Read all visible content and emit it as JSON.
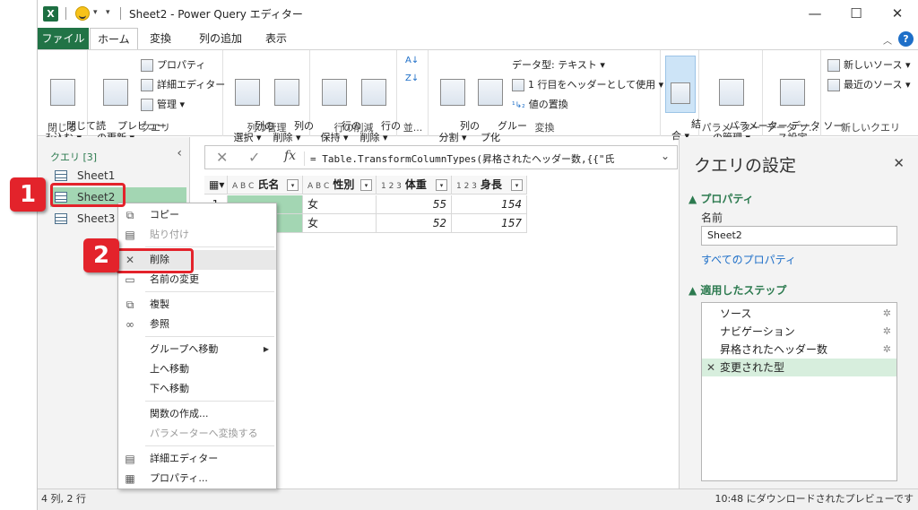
{
  "title": {
    "app_icon": "X",
    "window_title": "Sheet2 - Power Query エディター",
    "minimize": "—",
    "maximize": "☐",
    "close": "✕"
  },
  "tabs": [
    "ファイル",
    "ホーム",
    "変換",
    "列の追加",
    "表示"
  ],
  "ribbon": {
    "close_group": {
      "button": "閉じて読\nみ込む ▾",
      "label": "閉じる"
    },
    "query_group": {
      "preview": "プレビュー\nの更新 ▾",
      "properties": "プロパティ",
      "advanced_editor": "詳細エディター",
      "manage": "管理 ▾",
      "label": "クエリ"
    },
    "column_manage_group": {
      "select_columns": "列の\n選択 ▾",
      "remove_columns": "列の\n削除 ▾",
      "label": "列の管理"
    },
    "row_reduce_group": {
      "keep_rows": "行の\n保持 ▾",
      "remove_rows": "行の\n削除 ▾",
      "label": "行の削減"
    },
    "sort_group": {
      "label": "並..."
    },
    "transform_group": {
      "split_column": "列の\n分割 ▾",
      "group_by": "グルー\nプ化",
      "data_type": "データ型: テキスト ▾",
      "use_first_row": "1 行目をヘッダーとして使用 ▾",
      "replace_values": "値の置換",
      "label": "変換"
    },
    "combine_group": {
      "combine": "結\n合 ▾"
    },
    "parameter_group": {
      "manage_parameters": "パラメーター\nの管理 ▾",
      "label": "パラメーター"
    },
    "datasource_group": {
      "settings": "データ ソー\nス設定",
      "label": "データ ソ..."
    },
    "newquery_group": {
      "new_source": "新しいソース ▾",
      "recent_sources": "最近のソース ▾",
      "label": "新しいクエリ"
    }
  },
  "queries": {
    "header": "クエリ [3]",
    "items": [
      "Sheet1",
      "Sheet2",
      "Sheet3"
    ],
    "selected": "Sheet2"
  },
  "markers": {
    "one": "1",
    "two": "2"
  },
  "formula": {
    "text": "= Table.TransformColumnTypes(昇格されたヘッダー数,{{\"氏"
  },
  "grid": {
    "columns": [
      {
        "type": "A B C",
        "name": "氏名"
      },
      {
        "type": "A B C",
        "name": "性別"
      },
      {
        "type": "1 2 3",
        "name": "体重"
      },
      {
        "type": "1 2 3",
        "name": "身長"
      }
    ],
    "rows": [
      [
        "1",
        "",
        "女",
        "55",
        "154"
      ],
      [
        "2",
        "",
        "女",
        "52",
        "157"
      ]
    ]
  },
  "context_menu": {
    "items": [
      {
        "label": "コピー",
        "icon": "copy-icon",
        "disabled": false
      },
      {
        "label": "貼り付け",
        "icon": "paste-icon",
        "disabled": true
      },
      {
        "label": "削除",
        "icon": "delete-icon",
        "disabled": false
      },
      {
        "label": "名前の変更",
        "icon": "rename-icon",
        "disabled": false
      },
      {
        "label": "複製",
        "icon": "duplicate-icon",
        "disabled": false
      },
      {
        "label": "参照",
        "icon": "reference-icon",
        "disabled": false
      },
      {
        "label": "グループへ移動",
        "icon": "",
        "disabled": false
      },
      {
        "label": "上へ移動",
        "icon": "",
        "disabled": false
      },
      {
        "label": "下へ移動",
        "icon": "",
        "disabled": false
      },
      {
        "label": "関数の作成...",
        "icon": "",
        "disabled": false
      },
      {
        "label": "パラメーターへ変換する",
        "icon": "",
        "disabled": true
      },
      {
        "label": "詳細エディター",
        "icon": "advanced-editor-icon",
        "disabled": false
      },
      {
        "label": "プロパティ...",
        "icon": "properties-icon",
        "disabled": false
      }
    ]
  },
  "settings": {
    "title": "クエリの設定",
    "properties_section": "▲ プロパティ",
    "name_label": "名前",
    "name_value": "Sheet2",
    "all_properties": "すべてのプロパティ",
    "steps_section": "▲ 適用したステップ",
    "steps": [
      "ソース",
      "ナビゲーション",
      "昇格されたヘッダー数",
      "変更された型"
    ],
    "selected_step": "変更された型"
  },
  "status": {
    "left": "4 列, 2 行",
    "right": "10:48 にダウンロードされたプレビューです"
  }
}
